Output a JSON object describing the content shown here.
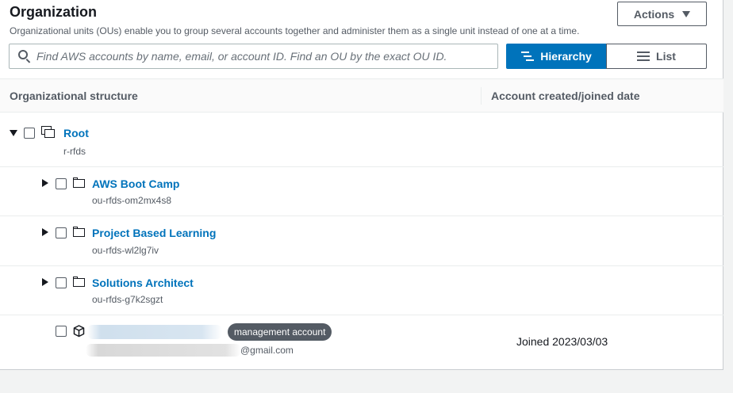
{
  "header": {
    "title": "Organization",
    "description": "Organizational units (OUs) enable you to group several accounts together and administer them as a single unit instead of one at a time.",
    "actions_label": "Actions"
  },
  "search": {
    "placeholder": "Find AWS accounts by name, email, or account ID. Find an OU by the exact OU ID."
  },
  "view_toggle": {
    "hierarchy_label": "Hierarchy",
    "list_label": "List",
    "selected": "Hierarchy"
  },
  "table": {
    "columns": [
      "Organizational structure",
      "Account created/joined date"
    ]
  },
  "tree": {
    "root": {
      "name": "Root",
      "id": "r-rfds"
    },
    "ous": [
      {
        "name": "AWS Boot Camp",
        "id": "ou-rfds-om2mx4s8"
      },
      {
        "name": "Project Based Learning",
        "id": "ou-rfds-wl2lg7iv"
      },
      {
        "name": "Solutions Architect",
        "id": "ou-rfds-g7k2sgzt"
      }
    ],
    "account": {
      "badge": "management account",
      "email_suffix": "@gmail.com",
      "joined": "Joined 2023/03/03"
    }
  },
  "colors": {
    "link": "#0073bb",
    "primary_button": "#0073bb",
    "badge_bg": "#545b64",
    "text": "#16191f",
    "muted_text": "#545b64"
  }
}
